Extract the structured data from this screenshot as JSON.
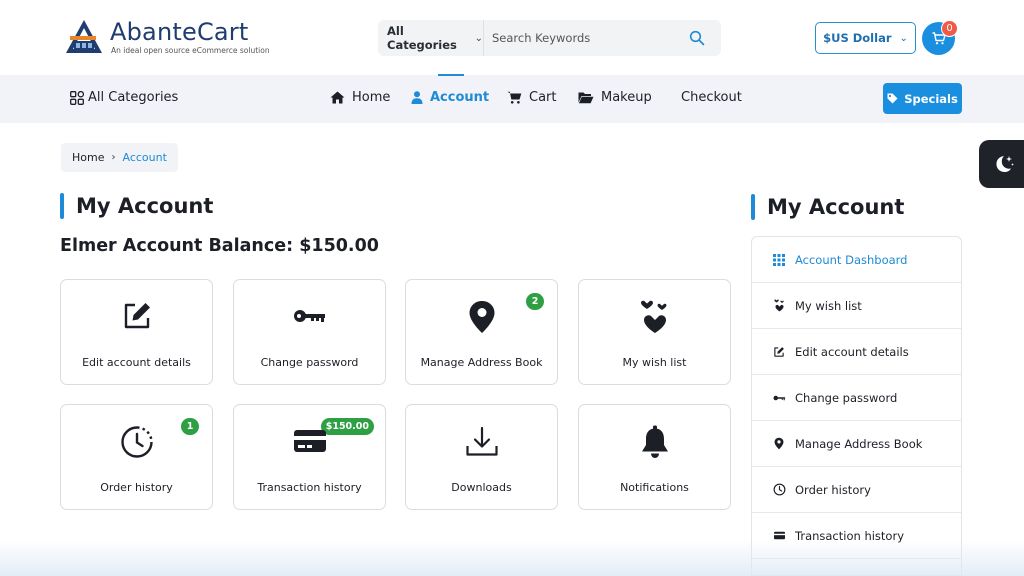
{
  "brand": {
    "name": "AbanteCart",
    "tagline": "An ideal open source eCommerce solution"
  },
  "search": {
    "category": "All Categories",
    "placeholder": "Search Keywords",
    "value": ""
  },
  "currency": {
    "selected": "$US Dollar"
  },
  "cart": {
    "count": "0"
  },
  "nav": {
    "all_categories": "All Categories",
    "items": [
      {
        "label": "Home",
        "icon": "home-icon"
      },
      {
        "label": "Account",
        "icon": "user-icon",
        "active": true
      },
      {
        "label": "Cart",
        "icon": "cart-icon"
      },
      {
        "label": "Makeup",
        "icon": "folder-icon"
      },
      {
        "label": "Checkout"
      }
    ],
    "specials": "Specials"
  },
  "breadcrumb": {
    "home": "Home",
    "current": "Account"
  },
  "main": {
    "title": "My Account",
    "balance": "Elmer Account Balance: $150.00",
    "tiles": [
      {
        "label": "Edit account details",
        "icon": "edit-icon"
      },
      {
        "label": "Change password",
        "icon": "key-icon"
      },
      {
        "label": "Manage Address Book",
        "icon": "map-pin-icon",
        "badge": "2"
      },
      {
        "label": "My wish list",
        "icon": "hearts-icon"
      },
      {
        "label": "Order history",
        "icon": "clock-icon",
        "badge": "1"
      },
      {
        "label": "Transaction history",
        "icon": "credit-card-icon",
        "badge": "$150.00"
      },
      {
        "label": "Downloads",
        "icon": "download-icon"
      },
      {
        "label": "Notifications",
        "icon": "bell-icon"
      }
    ]
  },
  "sidebar": {
    "title": "My Account",
    "items": [
      {
        "label": "Account Dashboard",
        "icon": "grid-icon",
        "active": true
      },
      {
        "label": "My wish list",
        "icon": "hearts-icon"
      },
      {
        "label": "Edit account details",
        "icon": "edit-icon"
      },
      {
        "label": "Change password",
        "icon": "key-icon"
      },
      {
        "label": "Manage Address Book",
        "icon": "map-pin-icon"
      },
      {
        "label": "Order history",
        "icon": "clock-icon"
      },
      {
        "label": "Transaction history",
        "icon": "credit-card-icon"
      }
    ]
  },
  "colors": {
    "accent": "#1f8ad6",
    "button": "#1a8fe0",
    "badge_green": "#2ea043",
    "cart_badge": "#f05a47",
    "nav_bg": "#f1f3f8"
  }
}
